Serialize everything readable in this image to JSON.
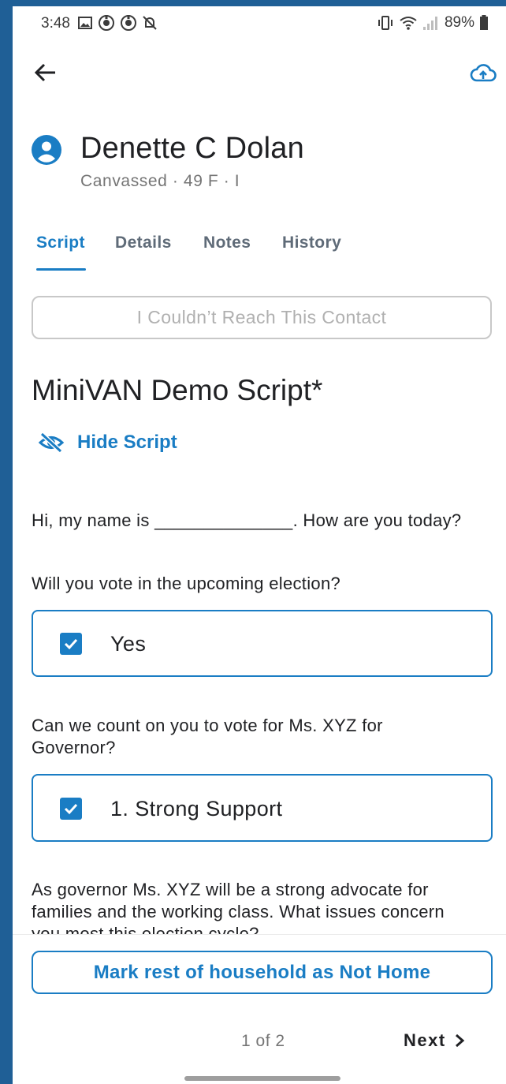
{
  "status_bar": {
    "time": "3:48",
    "left_icons": [
      "gallery-icon",
      "vpn-icon",
      "vpn-icon",
      "no-notifications-icon"
    ],
    "right_icons": [
      "vibrate-icon",
      "wifi-icon",
      "signal-icon"
    ],
    "battery": "89%"
  },
  "app_bar": {
    "back_icon": "arrow-back-icon",
    "upload_icon": "cloud-upload-icon"
  },
  "contact": {
    "name": "Denette C Dolan",
    "subtitle": "Canvassed · 49 F · I"
  },
  "tabs": [
    {
      "label": "Script",
      "active": true
    },
    {
      "label": "Details",
      "active": false
    },
    {
      "label": "Notes",
      "active": false
    },
    {
      "label": "History",
      "active": false
    }
  ],
  "reach_button": "I Couldn’t Reach This Contact",
  "script": {
    "title": "MiniVAN Demo Script*",
    "hide_label": "Hide Script",
    "intro": "Hi, my name is ______________. How are you today?",
    "questions": [
      {
        "text": "Will you vote in the upcoming election?",
        "answer": "Yes",
        "checked": true
      },
      {
        "text": "Can we count on you to vote for Ms. XYZ for Governor?",
        "answer": "1. Strong Support",
        "checked": true
      }
    ],
    "next_question": "As governor Ms. XYZ will be a strong advocate for families and the working class.  What issues concern you most this election cycle?"
  },
  "footer": {
    "mark_household": "Mark rest of household as Not Home",
    "pager": "1 of 2",
    "next_label": "Next"
  },
  "colors": {
    "accent": "#1a7dc4",
    "edge": "#1f5f96"
  }
}
